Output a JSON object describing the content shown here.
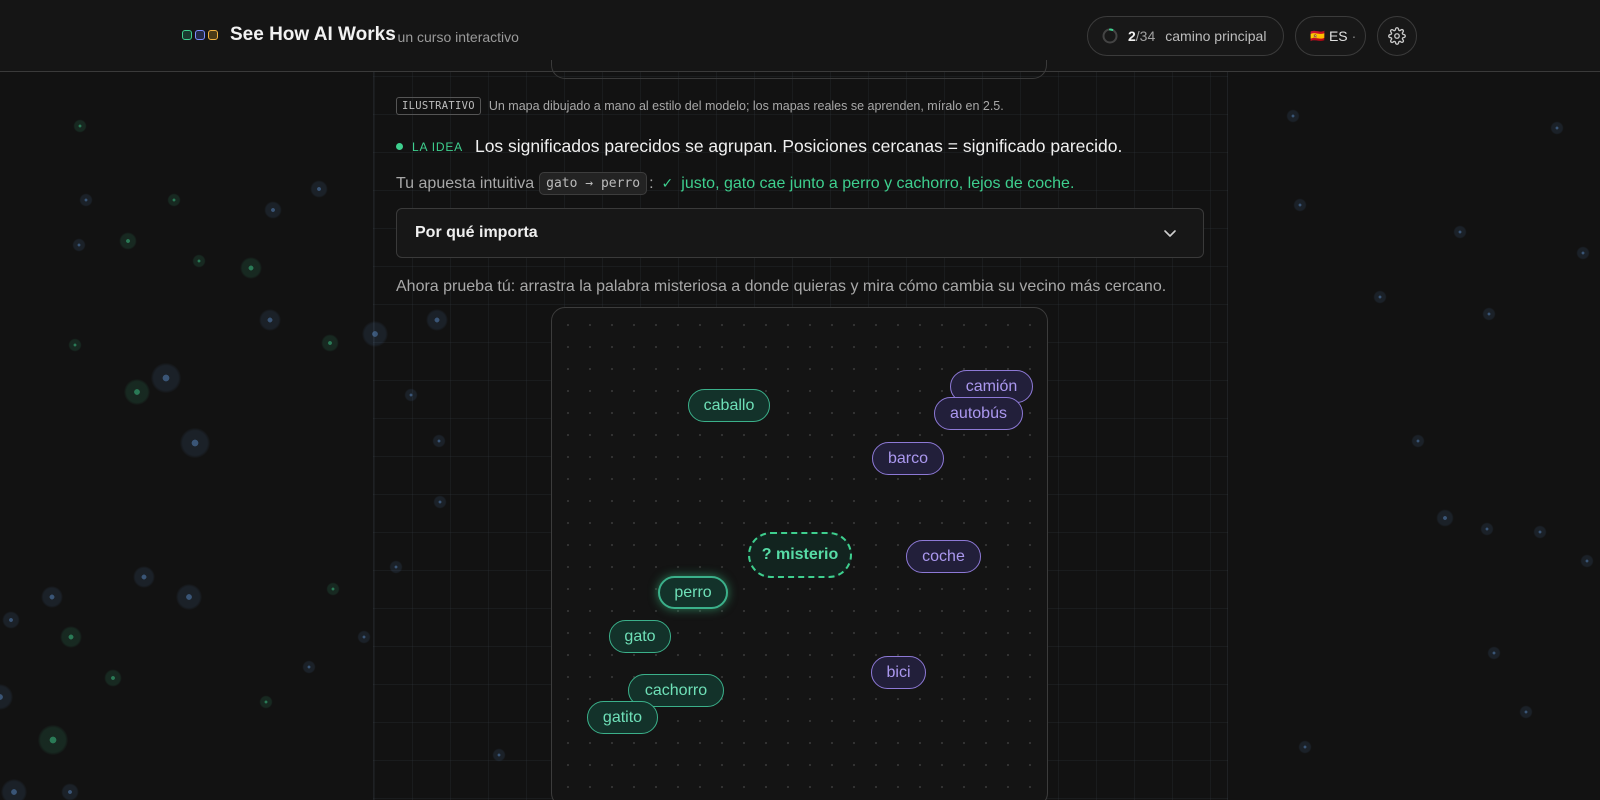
{
  "app": {
    "title": "See How AI Works",
    "subtitle": "· un curso interactivo",
    "logo_colors": [
      "#3ecf8e",
      "#7b8cff",
      "#f0b040"
    ]
  },
  "header": {
    "progress": {
      "current": "2",
      "total": "/34",
      "label": "camino principal",
      "fraction": 0.0588
    },
    "language": {
      "flag": "🇪🇸",
      "code": "ES",
      "suffix": "·"
    },
    "settings_icon": "gear-icon"
  },
  "illustrative": {
    "badge": "ILUSTRATIVO",
    "text": "Un mapa dibujado a mano al estilo del modelo; los mapas reales se aprenden, míralo en 2.5."
  },
  "idea": {
    "tag": "LA IDEA",
    "text": "Los significados parecidos se agrupan. Posiciones cercanas = significado parecido."
  },
  "guess": {
    "prefix": "Tu apuesta intuitiva",
    "code": "gato → perro",
    "colon": ":",
    "check_icon": "check-icon",
    "result": "justo, gato cae junto a perro y cachorro, lejos de coche."
  },
  "why": {
    "label": "Por qué importa",
    "icon": "chevron-down-icon"
  },
  "try_text": "Ahora prueba tú: arrastra la palabra misteriosa a donde quieras y mira cómo cambia su vecino más cercano.",
  "map": {
    "words": {
      "caballo": "caballo",
      "camion": "camión",
      "autobus": "autobús",
      "barco": "barco",
      "misterio": "? misterio",
      "coche": "coche",
      "perro": "perro",
      "gato": "gato",
      "bici": "bici",
      "cachorro": "cachorro",
      "gatito": "gatito"
    },
    "nearest_neighbor": "perro",
    "colors": {
      "animal": "#3ecf8e",
      "vehicle": "#8d79d6"
    }
  }
}
